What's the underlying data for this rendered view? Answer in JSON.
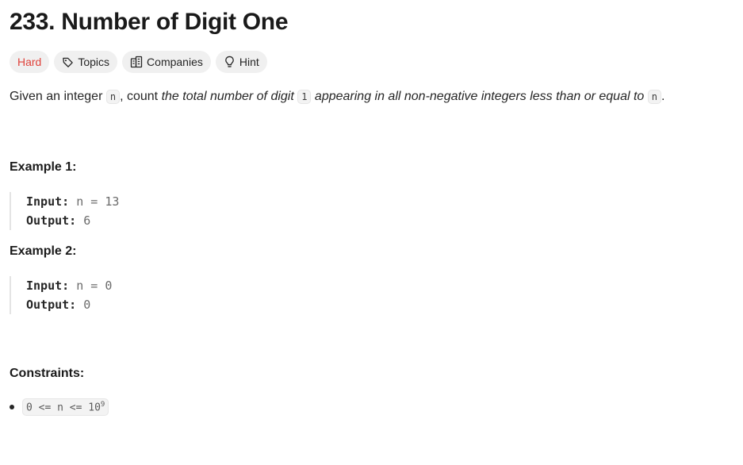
{
  "problem": {
    "number": "233.",
    "title": "Number of Digit One"
  },
  "tags": {
    "difficulty": "Hard",
    "topics": "Topics",
    "companies": "Companies",
    "hint": "Hint"
  },
  "icons": {
    "topics": "tag-icon",
    "companies": "building-icon",
    "hint": "lightbulb-icon"
  },
  "colors": {
    "difficulty": "#e0423b",
    "tag_bg": "#f0f0f0"
  },
  "description": {
    "prefix": "Given an integer ",
    "var_n": "n",
    "mid": ", count ",
    "italic_1": "the total number of digit ",
    "digit": "1",
    "italic_2": " appearing in all non-negative integers less than or equal to ",
    "var_n2": "n",
    "suffix": "."
  },
  "examples": [
    {
      "title": "Example 1:",
      "input_label": "Input:",
      "input_value": "n = 13",
      "output_label": "Output:",
      "output_value": "6"
    },
    {
      "title": "Example 2:",
      "input_label": "Input:",
      "input_value": "n = 0",
      "output_label": "Output:",
      "output_value": "0"
    }
  ],
  "constraints": {
    "title": "Constraints:",
    "items": [
      {
        "base": "0 <= n <= 10",
        "exponent": "9"
      }
    ]
  }
}
